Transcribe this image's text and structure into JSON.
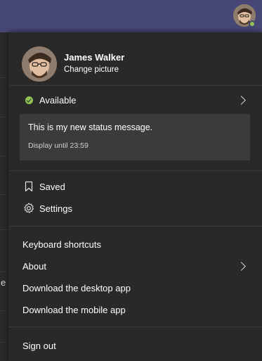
{
  "colors": {
    "topbar": "#464775",
    "menu_bg": "#292929",
    "status_message_bg": "#3b3b3b",
    "available_green": "#92c353"
  },
  "topbar": {
    "avatar_icon": "user-avatar-icon",
    "presence": "available"
  },
  "background": {
    "partial_text": "e"
  },
  "profile": {
    "name": "James Walker",
    "change_picture": "Change picture"
  },
  "status": {
    "label": "Available",
    "icon": "available-check-icon"
  },
  "status_message": {
    "text": "This is my new status message.",
    "until": "Display until 23:59"
  },
  "menu": {
    "saved": {
      "label": "Saved",
      "icon": "bookmark-icon"
    },
    "settings": {
      "label": "Settings",
      "icon": "gear-icon"
    },
    "keyboard_shortcuts": "Keyboard shortcuts",
    "about": "About",
    "download_desktop": "Download the desktop app",
    "download_mobile": "Download the mobile app",
    "sign_out": "Sign out"
  }
}
